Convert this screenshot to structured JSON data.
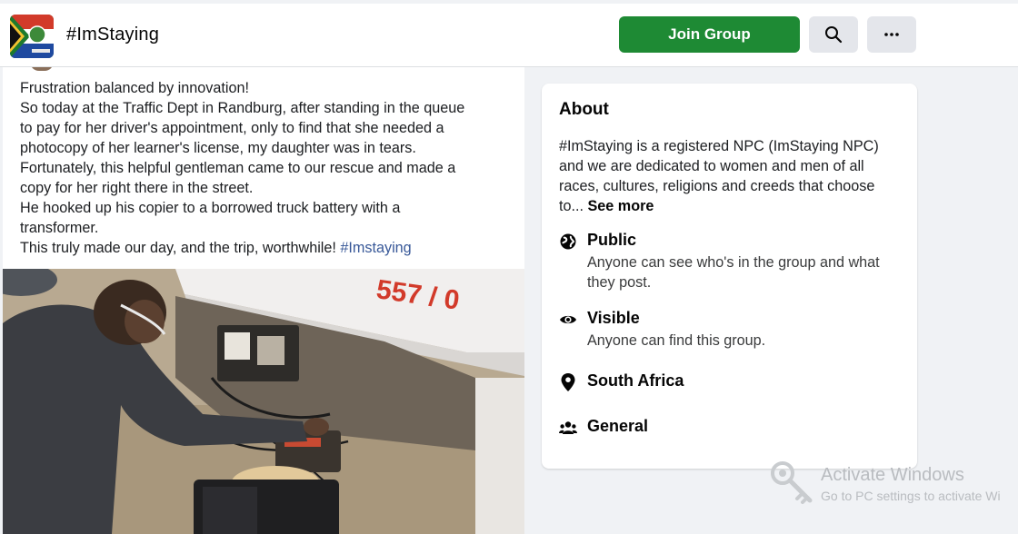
{
  "header": {
    "group_name": "#ImStaying",
    "join_button_label": "Join Group",
    "search_icon": "search-icon",
    "more_icon": "more-horizontal-icon",
    "join_color": "#1e8a34"
  },
  "post": {
    "lines": [
      "Frustration balanced by innovation!",
      "So today at the Traffic Dept in Randburg, after standing in the queue",
      "to pay for her driver's appointment, only to find that she needed a",
      "photocopy of her learner's license, my daughter was in tears.",
      "Fortunately, this helpful gentleman came to our rescue and made a",
      "copy for her right there in the street.",
      "He hooked up his copier to a borrowed truck battery with a",
      "transformer."
    ],
    "last_line_text": "This truly made our day, and the trip, worthwhile!",
    "hashtag": "#Imstaying",
    "hashtag_color": "#385898",
    "photo_sign_text": "557 / 0"
  },
  "about": {
    "title": "About",
    "description_lines": [
      "#ImStaying is a registered NPC (ImStaying NPC)",
      "and we are dedicated to women and men of all",
      "races, cultures, religions and creeds that choose"
    ],
    "description_last": "to...",
    "see_more": "See more",
    "items": [
      {
        "icon": "globe-icon",
        "title": "Public",
        "subtitle_lines": [
          "Anyone can see who's in the group and what",
          "they post."
        ]
      },
      {
        "icon": "eye-icon",
        "title": "Visible",
        "subtitle_lines": [
          "Anyone can find this group."
        ]
      },
      {
        "icon": "location-pin-icon",
        "title": "South Africa",
        "subtitle_lines": []
      },
      {
        "icon": "people-icon",
        "title": "General",
        "subtitle_lines": []
      }
    ]
  },
  "watermark": {
    "title": "Activate Windows",
    "subtitle": "Go to PC settings to activate Wi"
  }
}
